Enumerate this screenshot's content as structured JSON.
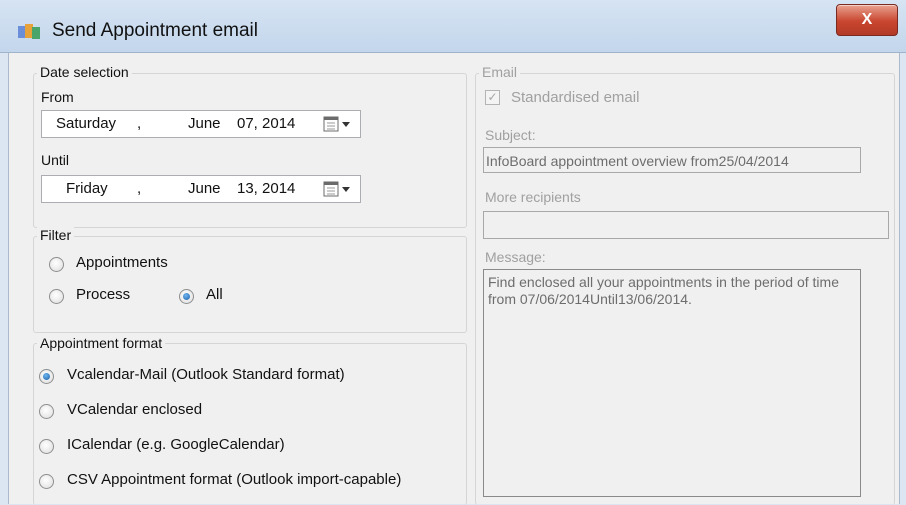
{
  "window": {
    "title": "Send Appointment email",
    "close_glyph": "X"
  },
  "date_selection": {
    "legend": "Date selection",
    "from_label": "From",
    "from": {
      "weekday": "Saturday",
      "sep": ",",
      "month": "June",
      "day_year": "07, 2014"
    },
    "until_label": "Until",
    "until": {
      "weekday": "Friday",
      "sep": ",",
      "month": "June",
      "day_year": "13, 2014"
    },
    "picker_icon": "calendar-dropdown-icon"
  },
  "filter": {
    "legend": "Filter",
    "options": [
      {
        "label": "Appointments",
        "checked": false
      },
      {
        "label": "Process",
        "checked": false
      },
      {
        "label": "All",
        "checked": true
      }
    ]
  },
  "appointment_format": {
    "legend": "Appointment format",
    "options": [
      {
        "label": "Vcalendar-Mail (Outlook Standard format)",
        "checked": true
      },
      {
        "label": "VCalendar enclosed",
        "checked": false
      },
      {
        "label": "ICalendar (e.g. GoogleCalendar)",
        "checked": false
      },
      {
        "label": "CSV Appointment format (Outlook import-capable)",
        "checked": false
      }
    ]
  },
  "email": {
    "legend": "Email",
    "standardised_label": "Standardised email",
    "standardised_checked": true,
    "subject_label": "Subject:",
    "subject_value": "InfoBoard appointment overview from25/04/2014",
    "recipients_label": "More recipients",
    "recipients_value": "",
    "message_label": "Message:",
    "message_value": "Find enclosed all your appointments in the period of time from 07/06/2014Until13/06/2014."
  }
}
